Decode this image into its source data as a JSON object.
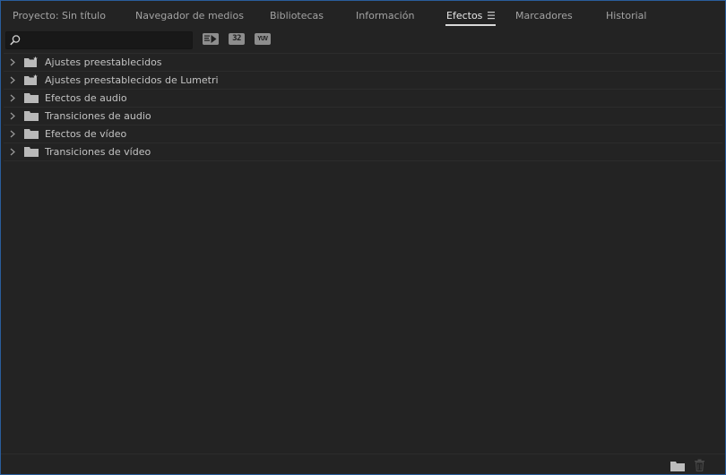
{
  "tabs": [
    {
      "label": "Proyecto: Sin título",
      "active": false
    },
    {
      "label": "Navegador de medios",
      "active": false
    },
    {
      "label": "Bibliotecas",
      "active": false
    },
    {
      "label": "Información",
      "active": false
    },
    {
      "label": "Efectos",
      "active": true
    },
    {
      "label": "Marcadores",
      "active": false
    },
    {
      "label": "Historial",
      "active": false
    }
  ],
  "tab_menu_icon": "hamburger-menu-icon",
  "search": {
    "value": "",
    "placeholder": "",
    "icon": "search-icon"
  },
  "filter_buttons": [
    {
      "name": "accelerated-effects-button",
      "icon": "accelerated-effects-icon",
      "text": ""
    },
    {
      "name": "32bit-effects-button",
      "icon": "32bit-icon",
      "text": "32"
    },
    {
      "name": "yuv-effects-button",
      "icon": "yuv-icon",
      "text": "YUV"
    }
  ],
  "folders": [
    {
      "label": "Ajustes preestablecidos",
      "icon": "preset-folder-icon"
    },
    {
      "label": "Ajustes preestablecidos de Lumetri",
      "icon": "preset-folder-icon"
    },
    {
      "label": "Efectos de audio",
      "icon": "folder-icon"
    },
    {
      "label": "Transiciones de audio",
      "icon": "folder-icon"
    },
    {
      "label": "Efectos de vídeo",
      "icon": "folder-icon"
    },
    {
      "label": "Transiciones de vídeo",
      "icon": "folder-icon"
    }
  ],
  "bottom_bar": {
    "new_bin_icon": "new-bin-icon",
    "delete_icon": "trash-icon"
  },
  "colors": {
    "accent_border": "#2a5d9c",
    "panel_bg": "#232323"
  }
}
